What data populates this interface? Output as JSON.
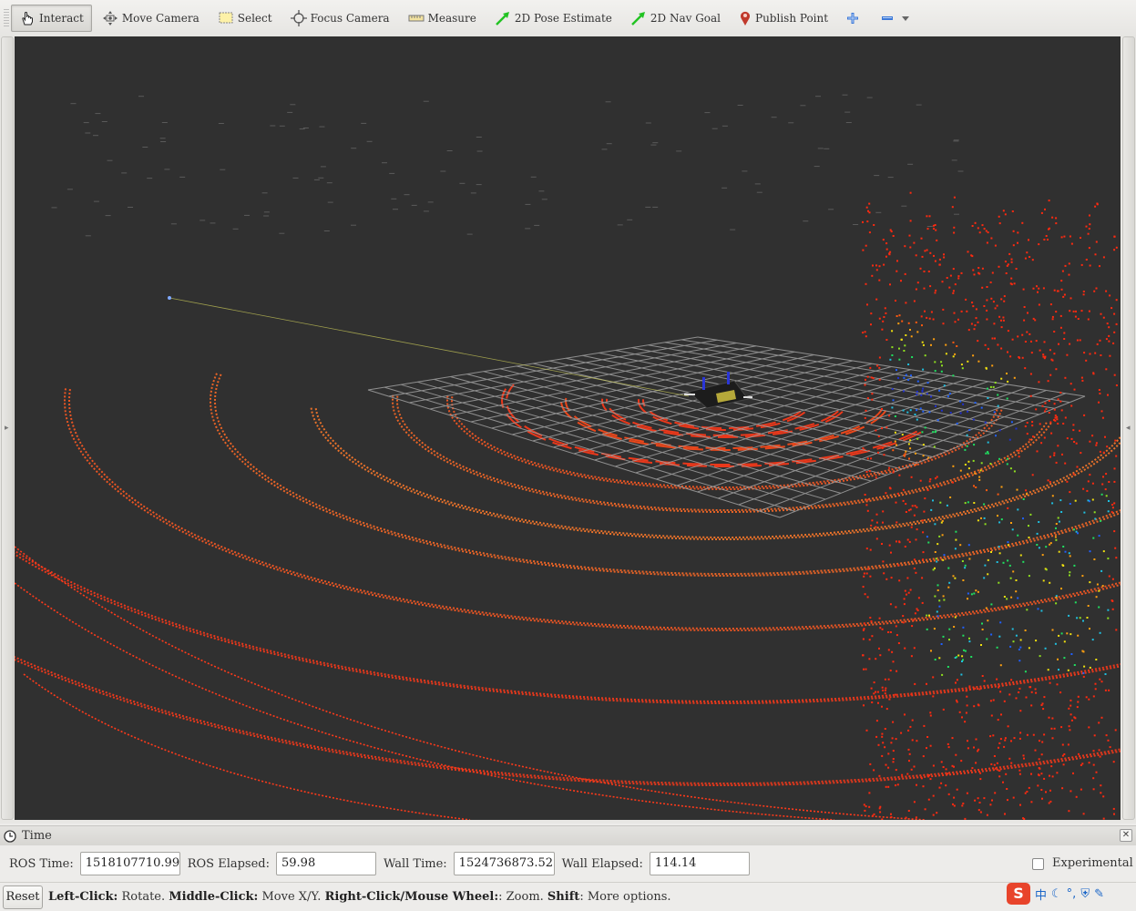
{
  "toolbar": {
    "tools": [
      {
        "label": "Interact",
        "icon": "hand-icon"
      },
      {
        "label": "Move Camera",
        "icon": "move-camera-icon"
      },
      {
        "label": "Select",
        "icon": "select-icon"
      },
      {
        "label": "Focus Camera",
        "icon": "focus-camera-icon"
      },
      {
        "label": "Measure",
        "icon": "ruler-icon"
      },
      {
        "label": "2D Pose Estimate",
        "icon": "green-arrow-icon"
      },
      {
        "label": "2D Nav Goal",
        "icon": "green-arrow-icon"
      },
      {
        "label": "Publish Point",
        "icon": "map-pin-icon"
      }
    ],
    "active_tool": "Interact"
  },
  "time_panel": {
    "title": "Time",
    "ros_time_label": "ROS Time:",
    "ros_time": "1518107710.99",
    "ros_elapsed_label": "ROS Elapsed:",
    "ros_elapsed": "59.98",
    "wall_time_label": "Wall Time:",
    "wall_time": "1524736873.52",
    "wall_elapsed_label": "Wall Elapsed:",
    "wall_elapsed": "114.14",
    "experimental_label": "Experimental",
    "experimental_checked": false
  },
  "status_bar": {
    "reset_label": "Reset",
    "hint_left_click": "Left-Click:",
    "hint_rotate": " Rotate. ",
    "hint_middle_click": "Middle-Click:",
    "hint_move": " Move X/Y. ",
    "hint_right_click": "Right-Click/Mouse Wheel:",
    "hint_zoom": ": Zoom. ",
    "hint_shift": "Shift",
    "hint_more": ": More options."
  },
  "ime_tray": {
    "logo": "S",
    "lang": "中"
  },
  "colors": {
    "viewport_bg": "#303030",
    "laser_red": "#ff3a1a",
    "laser_orange": "#ff7a2a",
    "grid": "#a0a0a0"
  }
}
